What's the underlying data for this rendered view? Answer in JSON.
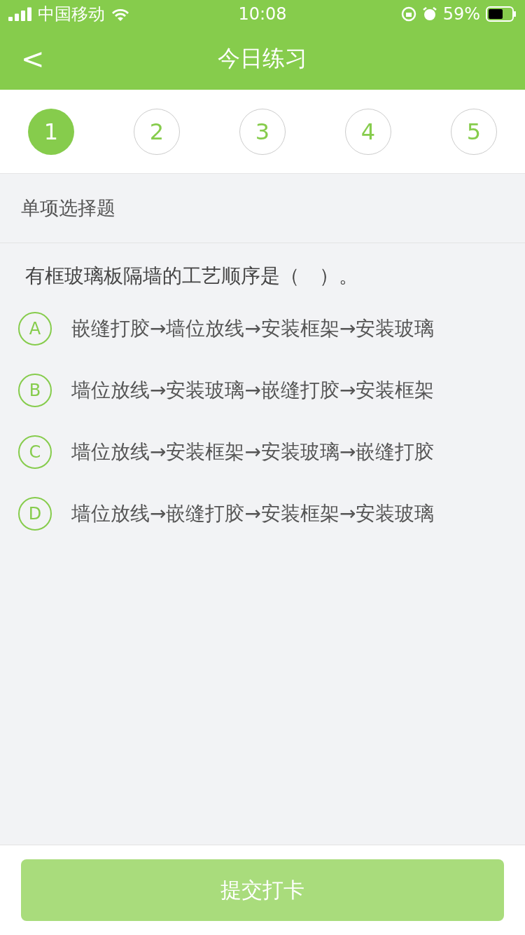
{
  "status_bar": {
    "carrier": "中国移动",
    "time": "10:08",
    "battery": "59%"
  },
  "nav": {
    "back": "<",
    "title": "今日练习"
  },
  "steps": [
    {
      "label": "1",
      "selected": true
    },
    {
      "label": "2",
      "selected": false
    },
    {
      "label": "3",
      "selected": false
    },
    {
      "label": "4",
      "selected": false
    },
    {
      "label": "5",
      "selected": false
    }
  ],
  "section": "单项选择题",
  "question": "有框玻璃板隔墙的工艺顺序是（　）。",
  "options": [
    {
      "letter": "A",
      "text": "嵌缝打胶→墙位放线→安装框架→安装玻璃",
      "selected": false
    },
    {
      "letter": "B",
      "text": "墙位放线→安装玻璃→嵌缝打胶→安装框架",
      "selected": false
    },
    {
      "letter": "C",
      "text": "墙位放线→安装框架→安装玻璃→嵌缝打胶",
      "selected": false
    },
    {
      "letter": "D",
      "text": "墙位放线→嵌缝打胶→安装框架→安装玻璃",
      "selected": false
    }
  ],
  "submit": {
    "label": "提交打卡",
    "disabled": true
  }
}
